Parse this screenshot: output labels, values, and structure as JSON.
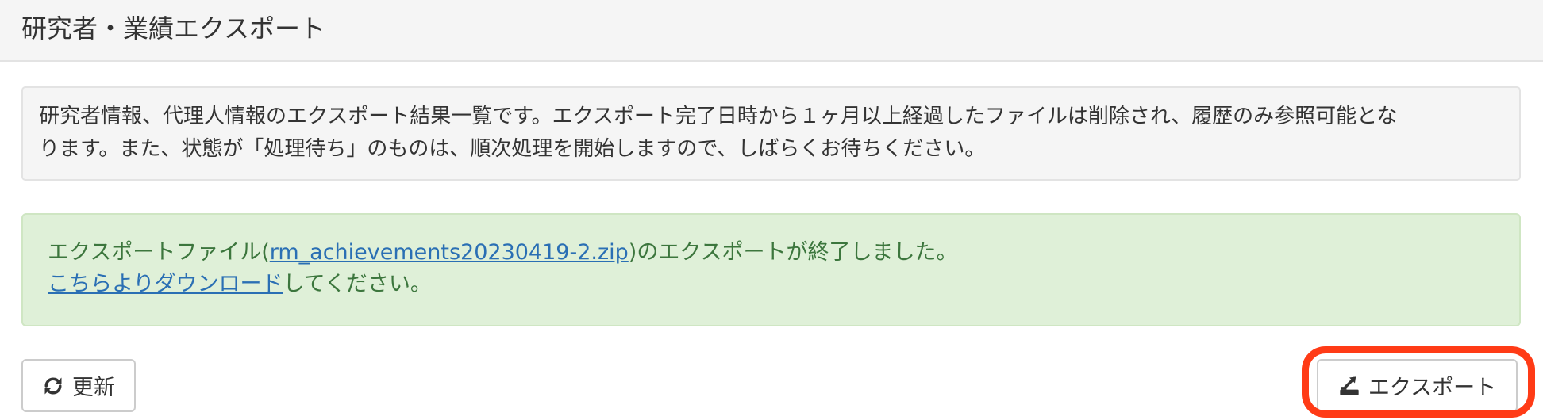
{
  "header": {
    "title": "研究者・業績エクスポート"
  },
  "info": {
    "line1": "研究者情報、代理人情報のエクスポート結果一覧です。エクスポート完了日時から１ヶ月以上経過したファイルは削除され、履歴のみ参照可能とな",
    "line2": "ります。また、状態が「処理待ち」のものは、順次処理を開始しますので、しばらくお待ちください。"
  },
  "alert": {
    "prefix": "エクスポートファイル(",
    "filename": "rm_achievements20230419-2.zip",
    "suffix": ")のエクスポートが終了しました。",
    "download_link": "こちらよりダウンロード",
    "download_suffix": "してください。",
    "color": "#3c763d",
    "background": "#dff0d8"
  },
  "buttons": {
    "refresh_label": "更新",
    "refresh_icon": "refresh-icon",
    "export_label": "エクスポート",
    "export_icon": "export-icon"
  },
  "annotation": {
    "highlight_color": "#ff3b16"
  }
}
